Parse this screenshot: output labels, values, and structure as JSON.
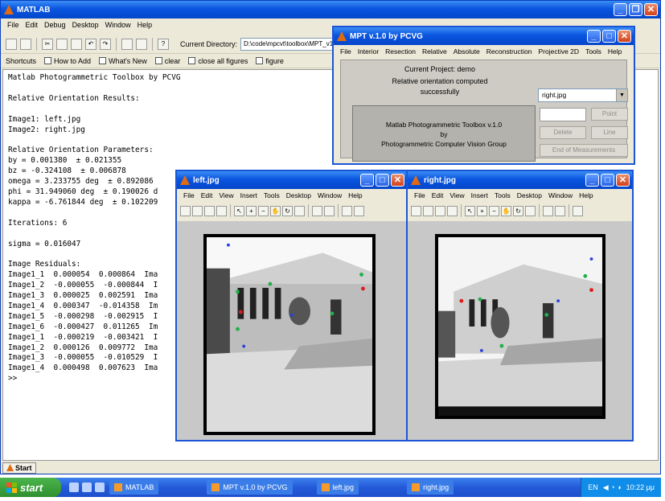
{
  "matlab": {
    "title": "MATLAB",
    "menu": [
      "File",
      "Edit",
      "Debug",
      "Desktop",
      "Window",
      "Help"
    ],
    "current_directory_label": "Current Directory:",
    "current_directory": "D:\\code\\mpcvt\\toolbox\\MPT_v1.0",
    "shortcuts": [
      "Shortcuts",
      "How to Add",
      "What's New",
      "clear",
      "close all figures",
      "figure"
    ],
    "console_lines": [
      "Matlab Photogrammetric Toolbox by PCVG",
      "",
      "Relative Orientation Results:",
      "",
      "Image1: left.jpg",
      "Image2: right.jpg",
      "",
      "Relative Orientation Parameters:",
      "by = 0.001380  ± 0.021355",
      "bz = -0.324108  ± 0.006878",
      "omega = 3.233755 deg  ± 0.892086",
      "phi = 31.949060 deg  ± 0.190026 d",
      "kappa = -6.761844 deg  ± 0.102209",
      "",
      "Iterations: 6",
      "",
      "sigma = 0.016047",
      "",
      "Image Residuals:",
      "Image1_1  0.000054  0.000864  Ima",
      "Image1_2  -0.000055  -0.000844  I",
      "Image1_3  0.000025  0.002591  Ima",
      "Image1_4  0.000347  -0.014358  Im",
      "Image1_5  -0.000298  -0.002915  I",
      "Image1_6  -0.000427  0.011265  Im",
      "Image1_1  -0.000219  -0.003421  I",
      "Image1_2  0.000126  0.009772  Ima",
      "Image1_3  -0.000055  -0.010529  I",
      "Image1_4  0.000498  0.007623  Ima",
      ">>"
    ],
    "start_label": "Start"
  },
  "mpt": {
    "title": "MPT v.1.0 by PCVG",
    "menu": [
      "File",
      "Interior",
      "Resection",
      "Relative",
      "Absolute",
      "Reconstruction",
      "Projective 2D",
      "Tools",
      "Help"
    ],
    "project_label": "Current Project: demo",
    "status_line1": "Relative orientation computed",
    "status_line2": "successfully",
    "info_line1": "Matlab Photogrammetric Toolbox v.1.0",
    "info_line2": "by",
    "info_line3": "Photogrammetric Computer Vision Group",
    "image_select": "right.jpg",
    "buttons": {
      "point": "Point",
      "delete": "Delete",
      "line": "Line",
      "end": "End of Measurements"
    }
  },
  "fig_left": {
    "title": "left.jpg",
    "menu": [
      "File",
      "Edit",
      "View",
      "Insert",
      "Tools",
      "Desktop",
      "Window",
      "Help"
    ]
  },
  "fig_right": {
    "title": "right.jpg",
    "menu": [
      "File",
      "Edit",
      "View",
      "Insert",
      "Tools",
      "Desktop",
      "Window",
      "Help"
    ]
  },
  "taskbar": {
    "start": "start",
    "tasks": [
      "MATLAB",
      "MPT v.1.0 by PCVG",
      "left.jpg",
      "right.jpg"
    ],
    "lang": "EN",
    "clock": "10:22 μμ"
  },
  "colors": {
    "xp_blue": "#0a55e0",
    "marker_green": "#21b04a",
    "marker_red": "#e01b1b",
    "marker_blue": "#2a3fe0"
  }
}
